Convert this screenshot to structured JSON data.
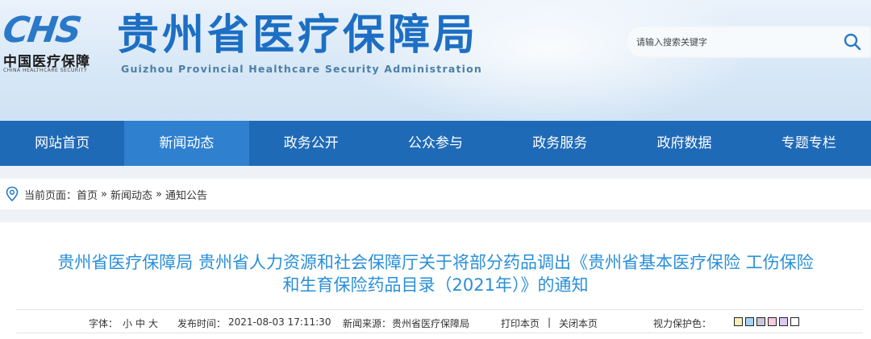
{
  "header": {
    "logo_mark": "CHS",
    "logo_cn": "中国医疗保障",
    "logo_en": "CHINA HEALTHCARE SECURITY",
    "title": "贵州省医疗保障局",
    "subtitle": "Guizhou Provincial Healthcare Security Administration"
  },
  "search": {
    "placeholder": "请输入搜索关键字",
    "icon": "search-icon"
  },
  "nav": {
    "items": [
      {
        "label": "网站首页"
      },
      {
        "label": "新闻动态",
        "active": true
      },
      {
        "label": "政务公开"
      },
      {
        "label": "公众参与"
      },
      {
        "label": "政务服务"
      },
      {
        "label": "政府数据"
      },
      {
        "label": "专题专栏"
      }
    ]
  },
  "breadcrumb": {
    "prefix": "当前页面：",
    "items": [
      "首页",
      "新闻动态",
      "通知公告"
    ],
    "separator": "»",
    "icon": "location-pin-icon"
  },
  "article": {
    "title_line1": "贵州省医疗保障局 贵州省人力资源和社会保障厅关于将部分药品调出《贵州省基本医疗保险 工伤保险",
    "title_line2": "和生育保险药品目录（2021年）》的通知"
  },
  "meta": {
    "font_label": "字体：",
    "font_small": "小",
    "font_medium": "中",
    "font_large": "大",
    "publish_label": "发布时间：",
    "publish_time": "2021-08-03 17:11:30",
    "source_label": "新闻来源：",
    "source": "贵州省医疗保障局",
    "print": "打印本页",
    "divider": "|",
    "close": "关闭本页",
    "eye_label": "视力保护色：",
    "swatch_colors": [
      "#f6f0b4",
      "#a7d4f2",
      "#c8c8d8",
      "#f5cce0",
      "#ddc8f0",
      "#ffffff"
    ]
  },
  "colors": {
    "brand_blue": "#1f6ab7",
    "nav_active": "#2f80cf",
    "title_blue": "#2a8fd8"
  }
}
